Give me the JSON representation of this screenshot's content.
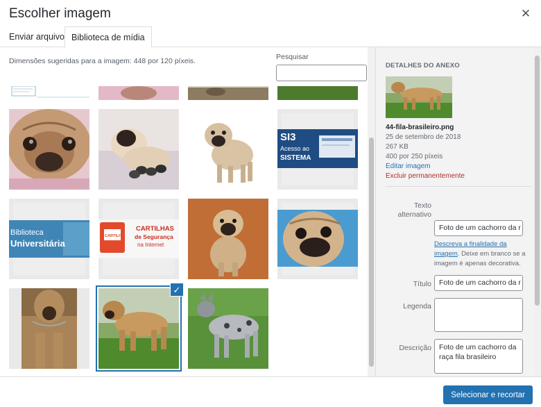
{
  "modal": {
    "title": "Escolher imagem"
  },
  "tabs": [
    {
      "label": "Enviar arquivos",
      "active": false
    },
    {
      "label": "Biblioteca de mídia",
      "active": true
    }
  ],
  "toolbar": {
    "dimensions_text": "Dimensões sugeridas para a imagem: 448 por 120 píxeis.",
    "search_label": "Pesquisar",
    "search_value": ""
  },
  "grid": {
    "items": [
      {
        "name": "partial-document-thumbnail"
      },
      {
        "name": "partial-pink-thumbnail"
      },
      {
        "name": "partial-dog-thumbnail"
      },
      {
        "name": "partial-grass-thumbnail"
      },
      {
        "name": "pug-face-closeup"
      },
      {
        "name": "pug-with-puppies"
      },
      {
        "name": "pug-standing"
      },
      {
        "name": "si3-banner",
        "text": "SI3 Acesso ao SISTEMA"
      },
      {
        "name": "biblioteca-banner",
        "text": "Biblioteca Universitária"
      },
      {
        "name": "cartilhas-banner",
        "text": "CARTILHAS de Segurança na Internet",
        "badge": "CARTILHA"
      },
      {
        "name": "pug-sitting"
      },
      {
        "name": "pug-face-blue-background"
      },
      {
        "name": "fila-brasileiro-front"
      },
      {
        "name": "fila-brasileiro-side",
        "selected": true
      },
      {
        "name": "cattle-dog"
      }
    ]
  },
  "details": {
    "heading": "DETALHES DO ANEXO",
    "filename": "44-fila-brasileiro.png",
    "date": "25 de setembro de 2018",
    "filesize": "267 KB",
    "dimensions": "400 por 250 píxeis",
    "edit_label": "Editar imagem",
    "delete_label": "Excluir permanentemente",
    "alt_label": "Texto alternativo",
    "alt_value": "Foto de um cachorro da r",
    "alt_help_link": "Descreva a finalidade da imagem",
    "alt_help_rest": ". Deixe em branco se a imagem é apenas decorativa.",
    "title_label": "Título",
    "title_value": "Foto de um cachorro da r",
    "caption_label": "Legenda",
    "caption_value": "",
    "description_label": "Descrição",
    "description_value": "Foto de um cachorro da raça fila brasileiro"
  },
  "footer": {
    "primary_label": "Selecionar e recortar"
  },
  "colors": {
    "accent": "#2271b1",
    "danger": "#b32d2e",
    "sidebar_bg": "#f3f3f3"
  }
}
